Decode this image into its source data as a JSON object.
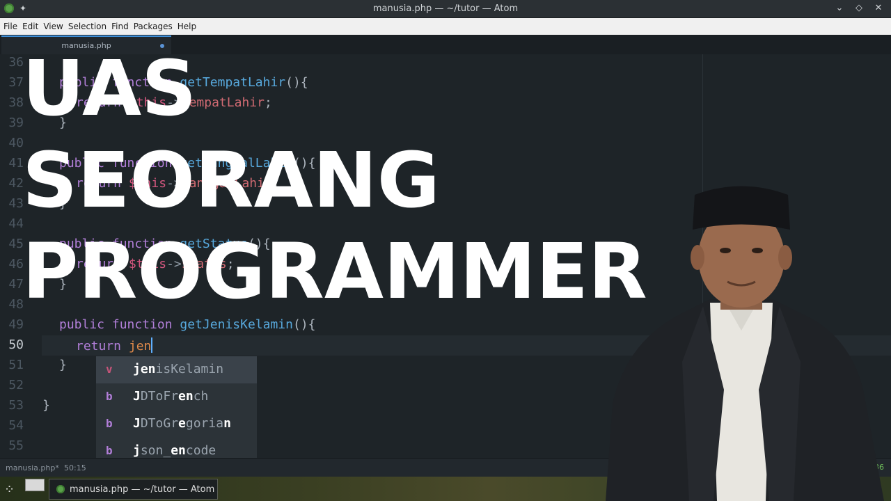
{
  "window": {
    "title": "manusia.php — ~/tutor — Atom"
  },
  "menu": [
    "File",
    "Edit",
    "View",
    "Selection",
    "Find",
    "Packages",
    "Help"
  ],
  "tab": {
    "label": "manusia.php"
  },
  "lines": [
    {
      "n": "36"
    },
    {
      "n": "37"
    },
    {
      "n": "38"
    },
    {
      "n": "39"
    },
    {
      "n": "40"
    },
    {
      "n": "41"
    },
    {
      "n": "42"
    },
    {
      "n": "43"
    },
    {
      "n": "44"
    },
    {
      "n": "45"
    },
    {
      "n": "46"
    },
    {
      "n": "47"
    },
    {
      "n": "48"
    },
    {
      "n": "49"
    },
    {
      "n": "50"
    },
    {
      "n": "51"
    },
    {
      "n": "52"
    },
    {
      "n": "53"
    },
    {
      "n": "54"
    },
    {
      "n": "55"
    }
  ],
  "code": {
    "l37": {
      "kw1": "public",
      "kw2": "function",
      "fn": "getTempatLahir",
      "tail": "(){"
    },
    "l38": {
      "kw": "return",
      "var": "$this",
      "op": "->",
      "prop": "tempatLahir",
      "tail": ";"
    },
    "l39": "}",
    "l41": {
      "kw1": "public",
      "kw2": "function",
      "fn": "getTanggalLahir",
      "tail": "(){"
    },
    "l42": {
      "kw": "return",
      "var": "$this",
      "op": "->",
      "prop": "tanggalLahir",
      "tail": ";"
    },
    "l43": "}",
    "l45": {
      "kw1": "public",
      "kw2": "function",
      "fn": "getStatus",
      "tail": "(){"
    },
    "l46": {
      "kw": "return",
      "var": "$this",
      "op": "->",
      "prop": "status",
      "tail": ";"
    },
    "l47": "}",
    "l49": {
      "kw1": "public",
      "kw2": "function",
      "fn": "getJenisKelamin",
      "tail": "(){"
    },
    "l50": {
      "kw": "return",
      "typed": "jen"
    },
    "l51": "}",
    "l53": "}"
  },
  "autocomplete": [
    {
      "badge": "v",
      "badge_color": "#c6557a",
      "parts": [
        {
          "t": "jen",
          "b": true
        },
        {
          "t": "isKelamin",
          "b": false
        }
      ]
    },
    {
      "badge": "b",
      "badge_color": "#b27fd9",
      "parts": [
        {
          "t": "J",
          "b": true
        },
        {
          "t": "DToFr",
          "b": false
        },
        {
          "t": "en",
          "b": true
        },
        {
          "t": "ch",
          "b": false
        }
      ]
    },
    {
      "badge": "b",
      "badge_color": "#b27fd9",
      "parts": [
        {
          "t": "J",
          "b": true
        },
        {
          "t": "DToGr",
          "b": false
        },
        {
          "t": "e",
          "b": true
        },
        {
          "t": "goria",
          "b": false
        },
        {
          "t": "n",
          "b": true
        }
      ]
    },
    {
      "badge": "b",
      "badge_color": "#b27fd9",
      "parts": [
        {
          "t": "j",
          "b": true
        },
        {
          "t": "son_",
          "b": false
        },
        {
          "t": "en",
          "b": true
        },
        {
          "t": "code",
          "b": false
        }
      ]
    }
  ],
  "status": {
    "file": "manusia.php*",
    "position": "50:15",
    "git": "+36"
  },
  "taskbar": {
    "window_label": "manusia.php — ~/tutor — Atom"
  },
  "overlay": {
    "line1": "UAS",
    "line2": "SEORANG",
    "line3": "PROGRAMMER"
  },
  "colors": {
    "accent": "#3f8fd8",
    "editor_bg": "#1e2428",
    "keyword": "#b27fd9",
    "function": "#57a8dc",
    "variable": "#d4577f"
  }
}
